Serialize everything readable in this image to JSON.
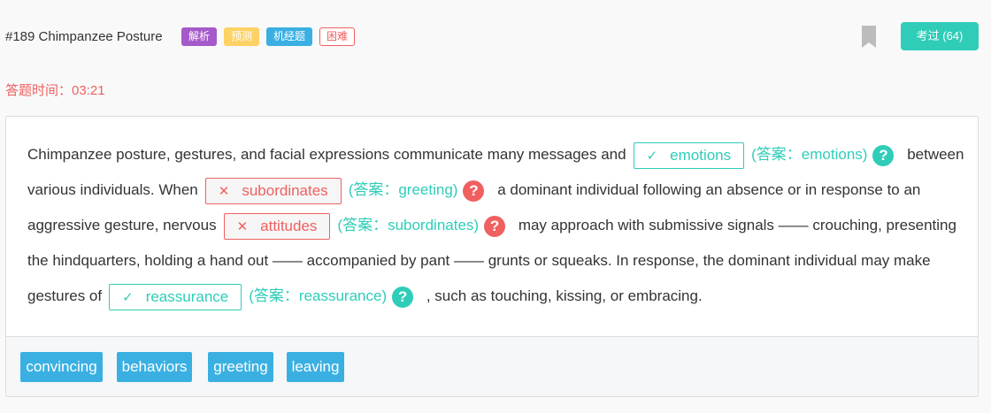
{
  "header": {
    "title": "#189 Chimpanzee Posture",
    "tags": [
      "解析",
      "预测",
      "机经题",
      "困难"
    ],
    "bookmark_icon": "bookmark-icon",
    "passed_button": "考过 (64)"
  },
  "timer": "答题时间：03:21",
  "passage": {
    "text1": "Chimpanzee posture, gestures, and facial expressions communicate many messages and",
    "blank1": {
      "mark": "✓",
      "value": "emotions",
      "status": "correct"
    },
    "ans1": "(答案：emotions)",
    "text2": "between various individuals. When",
    "blank2": {
      "mark": "✕",
      "value": "subordinates",
      "status": "wrong"
    },
    "ans2": "(答案：greeting)",
    "text3": "a dominant individual following an absence or in response to an aggressive gesture, nervous",
    "blank3": {
      "mark": "✕",
      "value": "attitudes",
      "status": "wrong"
    },
    "ans3": "(答案：subordinates)",
    "text4": "may approach with submissive signals —— crouching, presenting the hindquarters, holding a hand out —— accompanied by pant —— grunts or squeaks. In response, the dominant individual may make gestures of",
    "blank4": {
      "mark": "✓",
      "value": "reassurance",
      "status": "correct"
    },
    "ans4": "(答案：reassurance)",
    "text5": ", such as touching, kissing, or embracing.",
    "help_glyph": "?"
  },
  "options": [
    "convincing",
    "behaviors",
    "greeting",
    "leaving"
  ],
  "colors": {
    "accent": "#2fcdb8",
    "error": "#f06060",
    "chip": "#3ab0e2",
    "tag_analysis": "#a55ac9",
    "tag_predict": "#fdd264"
  }
}
